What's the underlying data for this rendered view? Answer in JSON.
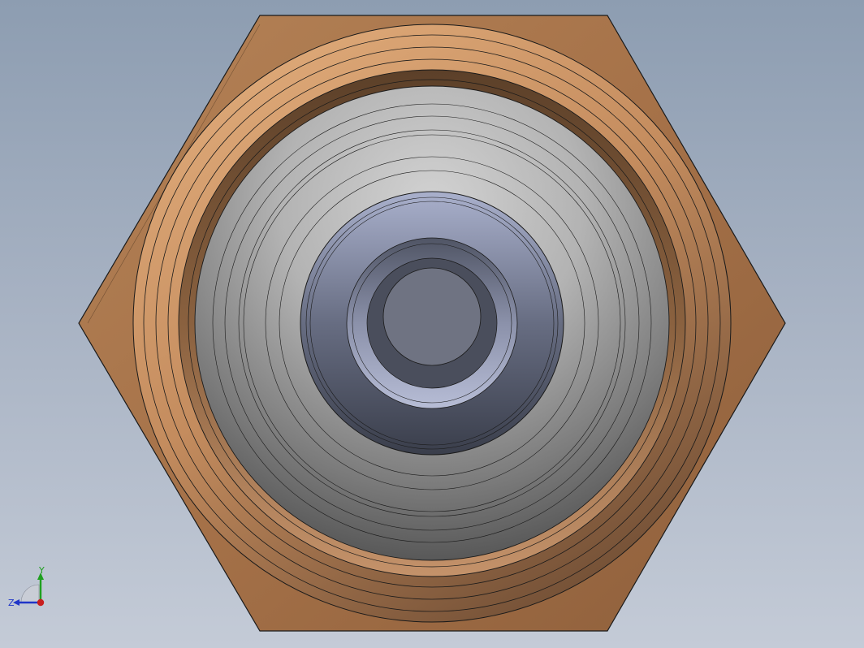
{
  "viewport": {
    "background_top": "#8d9db1",
    "background_bottom": "#c4cbd7"
  },
  "model": {
    "part": "hex-fitting-top-view",
    "colors": {
      "hex_body": "#a8774e",
      "hex_edge": "#1a1a1a",
      "copper_ring_light": "#d19a6c",
      "copper_ring_dark": "#6b4a32",
      "gray_cone_light": "#c0c0c0",
      "gray_cone_dark": "#4a4a4a",
      "center_metal_light": "#9fa6c2",
      "center_metal_dark": "#3b3f4c",
      "center_flat": "#6f7382"
    }
  },
  "triad": {
    "y_label": "Y",
    "z_label": "Z",
    "y_color": "#1fa01f",
    "z_color": "#2036c8",
    "x_color": "#c81e1e",
    "icon": "axis-triad-icon"
  }
}
